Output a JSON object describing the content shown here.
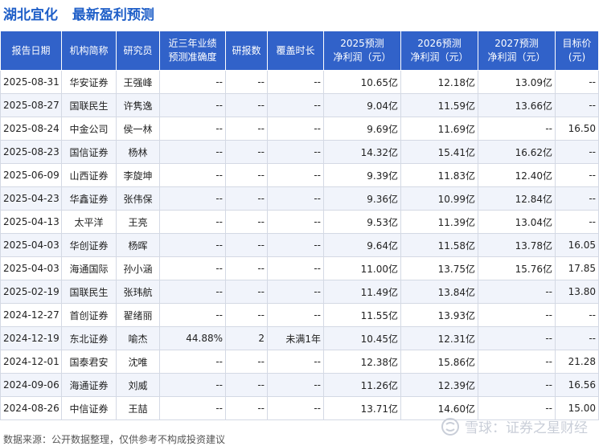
{
  "header": {
    "company": "湖北宜化",
    "subtitle": "最新盈利预测"
  },
  "table": {
    "columns": [
      "报告日期",
      "机构简称",
      "研究员",
      "近三年业绩\n预测准确度",
      "研报数",
      "覆盖时长",
      "2025预测\n净利润（元）",
      "2026预测\n净利润（元）",
      "2027预测\n净利润（元）",
      "目标价\n(元)"
    ],
    "rows": [
      [
        "2025-08-31",
        "华安证券",
        "王强峰",
        "--",
        "--",
        "--",
        "10.65亿",
        "12.18亿",
        "13.09亿",
        "--"
      ],
      [
        "2025-08-27",
        "国联民生",
        "许隽逸",
        "--",
        "--",
        "--",
        "9.04亿",
        "11.59亿",
        "13.66亿",
        "--"
      ],
      [
        "2025-08-24",
        "中金公司",
        "侯一林",
        "--",
        "--",
        "--",
        "9.69亿",
        "11.69亿",
        "--",
        "16.50"
      ],
      [
        "2025-08-23",
        "国信证券",
        "杨林",
        "--",
        "--",
        "--",
        "14.32亿",
        "15.41亿",
        "16.62亿",
        "--"
      ],
      [
        "2025-06-09",
        "山西证券",
        "李旋坤",
        "--",
        "--",
        "--",
        "9.39亿",
        "11.83亿",
        "12.40亿",
        "--"
      ],
      [
        "2025-04-23",
        "华鑫证券",
        "张伟保",
        "--",
        "--",
        "--",
        "9.36亿",
        "10.99亿",
        "12.84亿",
        "--"
      ],
      [
        "2025-04-13",
        "太平洋",
        "王亮",
        "--",
        "--",
        "--",
        "9.53亿",
        "11.39亿",
        "13.04亿",
        "--"
      ],
      [
        "2025-04-03",
        "华创证券",
        "杨晖",
        "--",
        "--",
        "--",
        "9.64亿",
        "11.58亿",
        "13.78亿",
        "16.05"
      ],
      [
        "2025-04-03",
        "海通国际",
        "孙小涵",
        "--",
        "--",
        "--",
        "11.00亿",
        "13.75亿",
        "15.76亿",
        "17.85"
      ],
      [
        "2025-02-19",
        "国联民生",
        "张玮航",
        "--",
        "--",
        "--",
        "11.49亿",
        "13.84亿",
        "--",
        "13.80"
      ],
      [
        "2024-12-27",
        "首创证券",
        "翟绪丽",
        "--",
        "--",
        "--",
        "11.55亿",
        "13.93亿",
        "--",
        "--"
      ],
      [
        "2024-12-19",
        "东北证券",
        "喻杰",
        "44.88%",
        "2",
        "未满1年",
        "10.45亿",
        "12.31亿",
        "--",
        "--"
      ],
      [
        "2024-12-01",
        "国泰君安",
        "沈唯",
        "--",
        "--",
        "--",
        "12.38亿",
        "15.86亿",
        "--",
        "21.28"
      ],
      [
        "2024-09-06",
        "海通证券",
        "刘威",
        "--",
        "--",
        "--",
        "11.26亿",
        "12.39亿",
        "--",
        "16.56"
      ],
      [
        "2024-08-26",
        "中信证券",
        "王喆",
        "--",
        "--",
        "--",
        "13.71亿",
        "14.60亿",
        "--",
        "15.00"
      ]
    ]
  },
  "footer": {
    "source": "数据来源：公开数据整理，仅供参考不构成投资建议"
  },
  "watermark": {
    "brand": "雪球：证券之星财经",
    "background": "证券之星"
  },
  "colors": {
    "header_bg": "#3162c9",
    "title": "#1f5fc8",
    "forecast_value": "#e0211b",
    "row_alt": "#f1f4fb"
  }
}
